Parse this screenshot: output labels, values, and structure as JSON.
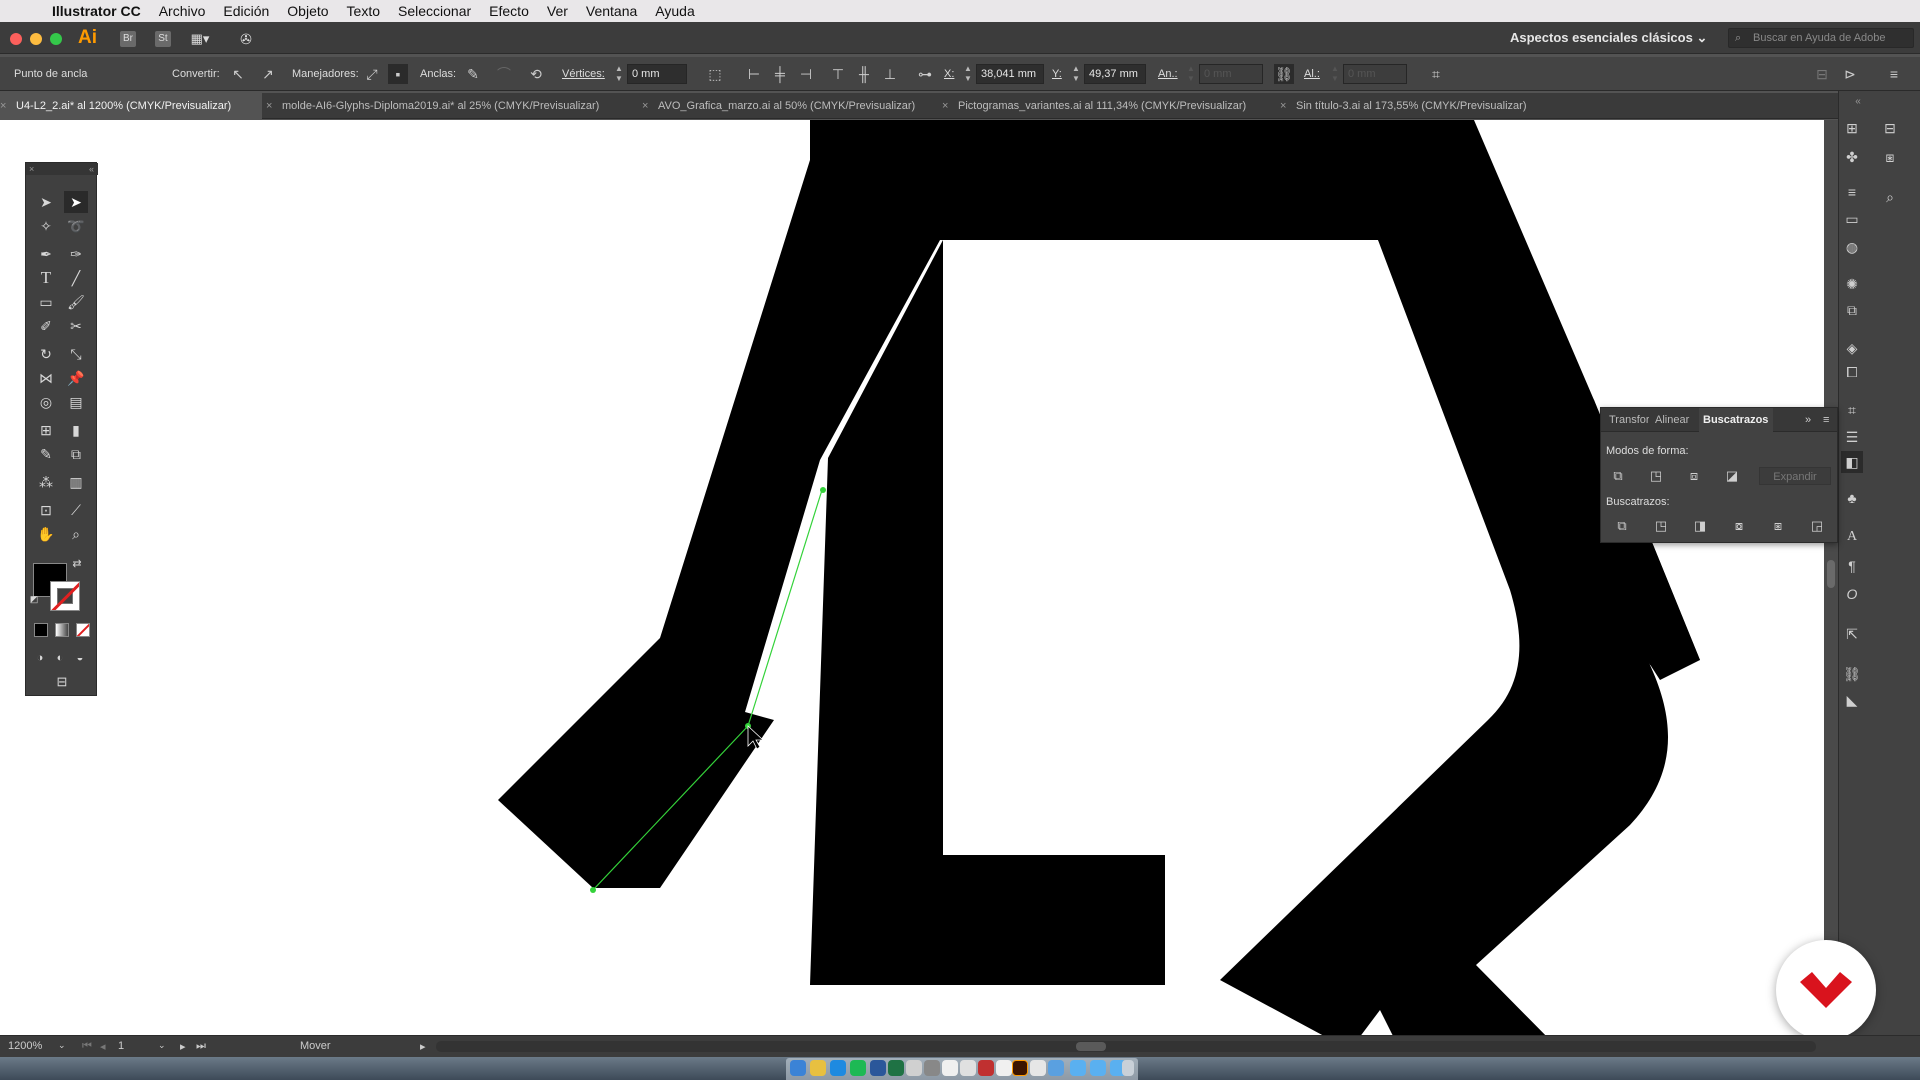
{
  "menubar": {
    "app": "Illustrator CC",
    "items": [
      "Archivo",
      "Edición",
      "Objeto",
      "Texto",
      "Seleccionar",
      "Efecto",
      "Ver",
      "Ventana",
      "Ayuda"
    ]
  },
  "appbar": {
    "logo": "Ai",
    "bridge": "Br",
    "stock": "St",
    "workspace": "Aspectos esenciales clásicos",
    "help_placeholder": "Buscar en Ayuda de Adobe"
  },
  "control": {
    "selection_label": "Punto de ancla",
    "convert_label": "Convertir:",
    "handles_label": "Manejadores:",
    "anchors_label": "Anclas:",
    "corners_label": "Vértices:",
    "corners_value": "0 mm",
    "x_label": "X:",
    "x_value": "38,041 mm",
    "y_label": "Y:",
    "y_value": "49,37 mm",
    "w_label": "An.:",
    "w_value": "0 mm",
    "h_label": "Al.:",
    "h_value": "0 mm"
  },
  "tabs": [
    {
      "label": "U4-L2_2.ai* al 1200% (CMYK/Previsualizar)",
      "active": true
    },
    {
      "label": "molde-AI6-Glyphs-Diploma2019.ai* al 25% (CMYK/Previsualizar)",
      "active": false
    },
    {
      "label": "AVO_Grafica_marzo.ai al 50% (CMYK/Previsualizar)",
      "active": false
    },
    {
      "label": "Pictogramas_variantes.ai al 111,34% (CMYK/Previsualizar)",
      "active": false
    },
    {
      "label": "Sin título-3.ai al 173,55% (CMYK/Previsualizar)",
      "active": false
    }
  ],
  "pathfinder": {
    "tabs": [
      "Transfor",
      "Alinear",
      "Buscatrazos"
    ],
    "shape_modes_label": "Modos de forma:",
    "pathfinders_label": "Buscatrazos:",
    "expand_label": "Expandir"
  },
  "status": {
    "zoom": "1200%",
    "artboard": "1",
    "tool": "Mover"
  },
  "colors": {
    "accent": "#ff9a00",
    "path_highlight": "#34d23a",
    "brand": "#d9131d",
    "fill": "#000000"
  }
}
